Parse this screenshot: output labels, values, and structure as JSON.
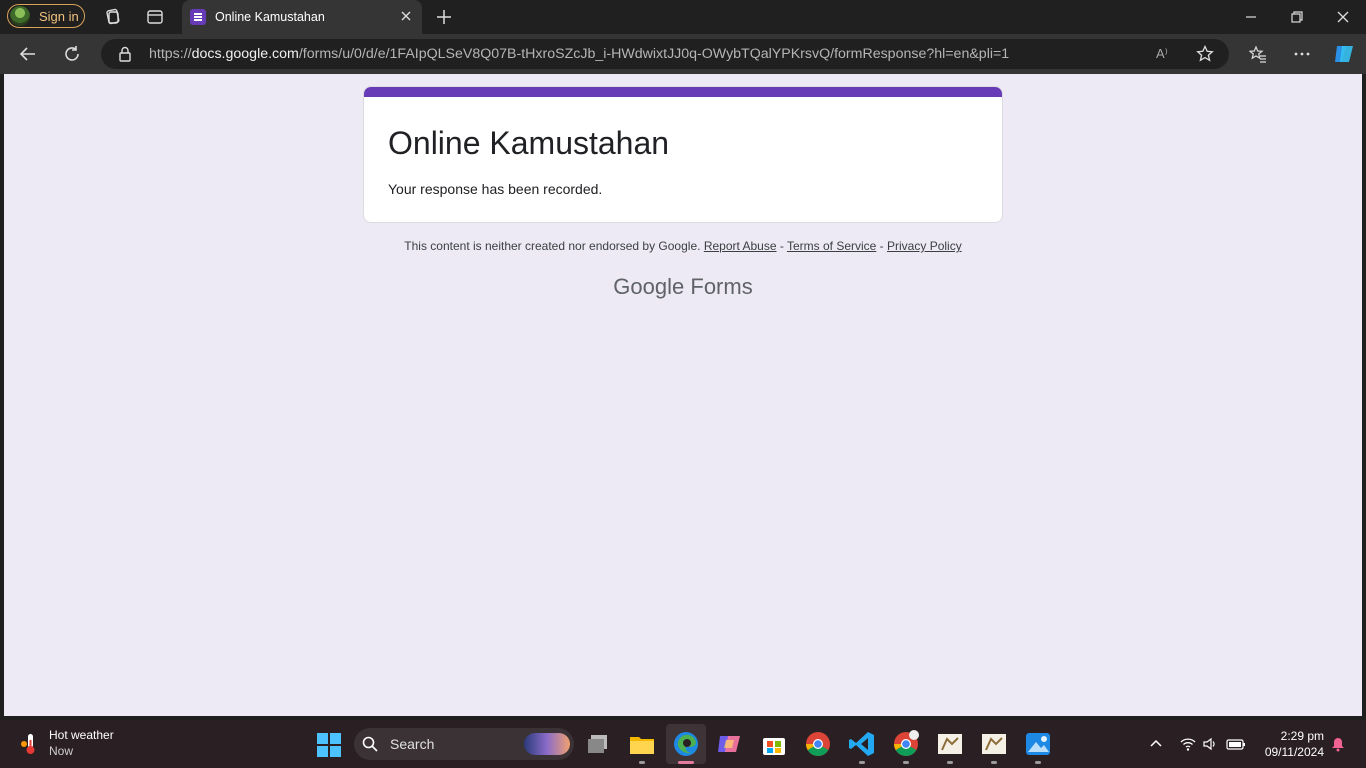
{
  "browser": {
    "sign_in_label": "Sign in",
    "tab_title": "Online Kamustahan",
    "url_host": "docs.google.com",
    "url_scheme": "https://",
    "url_path": "/forms/u/0/d/e/1FAIpQLSeV8Q07B-tHxroSZcJb_i-HWdwixtJJ0q-OWybTQalYPKrsvQ/formResponse?hl=en&pli=1",
    "read_aloud_glyph": "A⁾"
  },
  "form": {
    "title": "Online Kamustahan",
    "confirmation": "Your response has been recorded.",
    "accent_color": "#673ab7",
    "background_color": "#ede9f5"
  },
  "footer": {
    "notice": "This content is neither created nor endorsed by Google.",
    "report_abuse": "Report Abuse",
    "terms": "Terms of Service",
    "privacy": "Privacy Policy",
    "sep": " - ",
    "brand_google": "Google",
    "brand_forms": "Forms"
  },
  "taskbar": {
    "weather_title": "Hot weather",
    "weather_sub": "Now",
    "search_label": "Search",
    "time": "2:29 pm",
    "date": "09/11/2024"
  },
  "icons": [
    "workspaces-icon",
    "tab-actions-icon",
    "forms-favicon",
    "close-tab-icon",
    "new-tab-icon",
    "minimize-icon",
    "restore-icon",
    "close-window-icon",
    "back-icon",
    "refresh-icon",
    "lock-icon",
    "read-aloud-icon",
    "favorite-star-icon",
    "favorites-icon",
    "more-icon",
    "copilot-icon",
    "windows-start-icon",
    "task-view-icon",
    "file-explorer-icon",
    "edge-icon",
    "copilot-app-icon",
    "store-icon",
    "chrome-icon",
    "vscode-icon",
    "chrome-profile-icon",
    "app-icon",
    "app-icon-2",
    "photos-icon",
    "chevron-up-icon",
    "wifi-icon",
    "volume-icon",
    "battery-icon",
    "bell-icon"
  ]
}
